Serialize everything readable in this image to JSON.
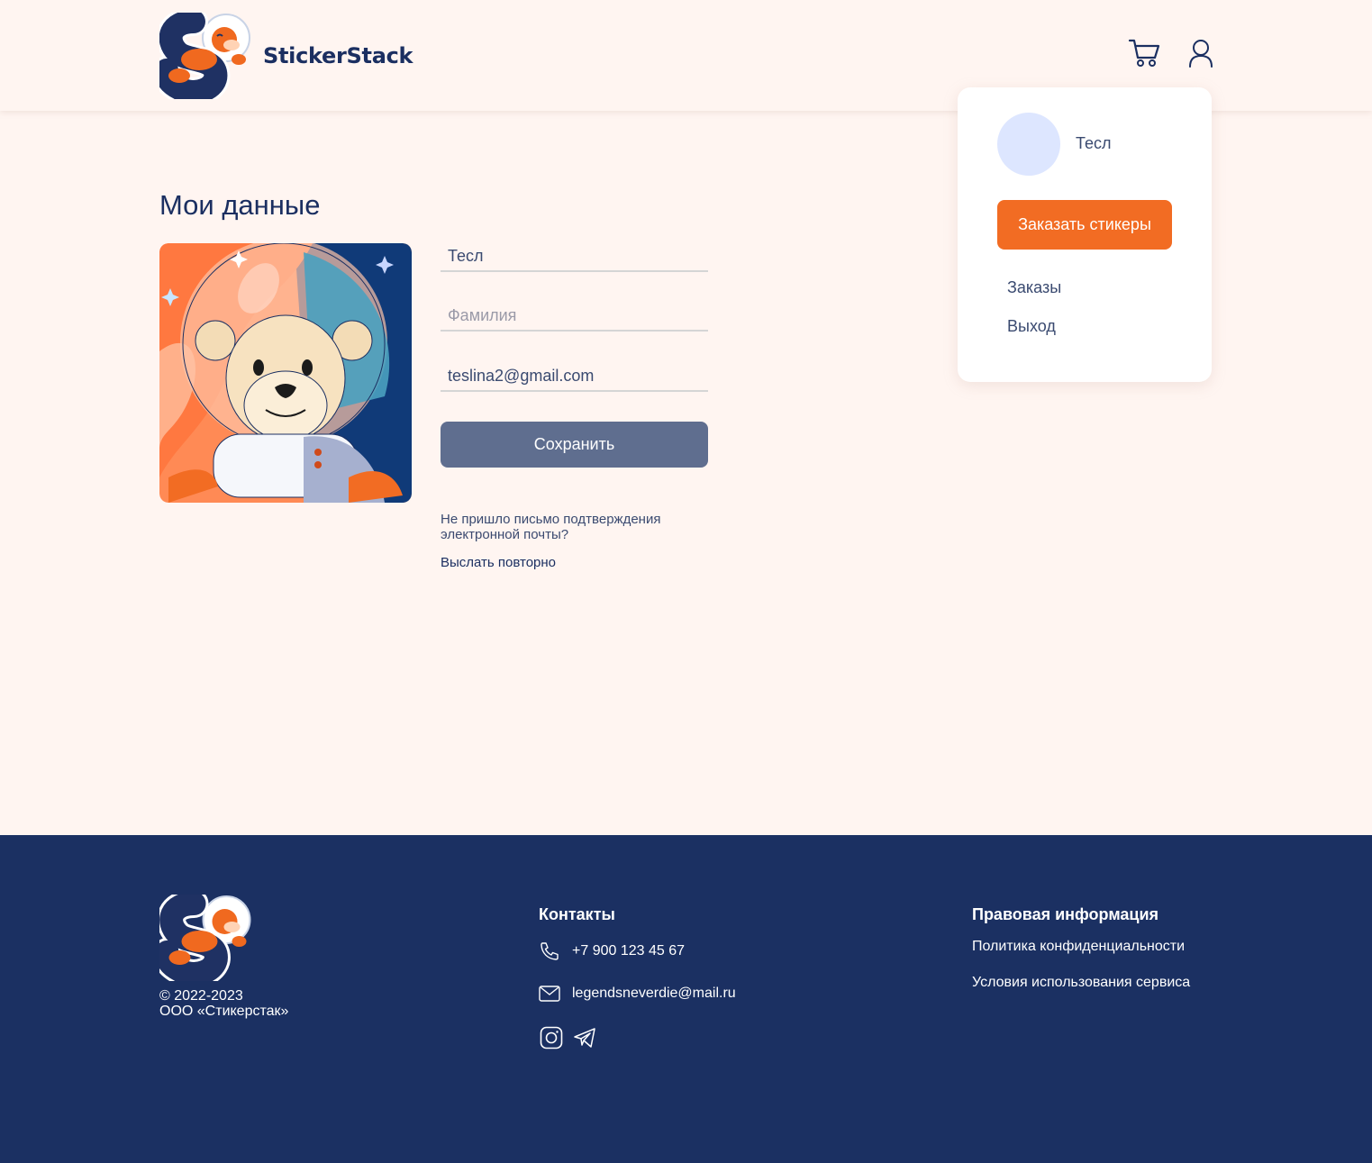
{
  "header": {
    "logo_text": "StickerStack",
    "cart_icon": "cart-icon",
    "user_icon": "user-icon"
  },
  "user_menu": {
    "name": "Тесл",
    "order_button": "Заказать стикеры",
    "orders_link": "Заказы",
    "logout_link": "Выход"
  },
  "main": {
    "title": "Мои данные",
    "form": {
      "first_name_value": "Тесл",
      "last_name_placeholder": "Фамилия",
      "email_value": "teslina2@gmail.com",
      "save_button": "Сохранить"
    },
    "confirm_note": "Не пришло письмо подтверждения электронной почты?",
    "resend_link": "Выслать повторно"
  },
  "footer": {
    "copyright_years": "© 2022-2023",
    "company": "ООО «Стикерстак»",
    "contacts_title": "Контакты",
    "phone": "+7 900 123 45 67",
    "email": "legendsneverdie@mail.ru",
    "legal_title": "Правовая информация",
    "privacy_link": "Политика конфиденциальности",
    "terms_link": "Условия использования сервиса"
  },
  "colors": {
    "page_bg": "#fff5f1",
    "primary_navy": "#1b3062",
    "accent_orange": "#f26c23",
    "save_button": "#5f6e8f",
    "avatar_placeholder": "#dde6ff"
  }
}
